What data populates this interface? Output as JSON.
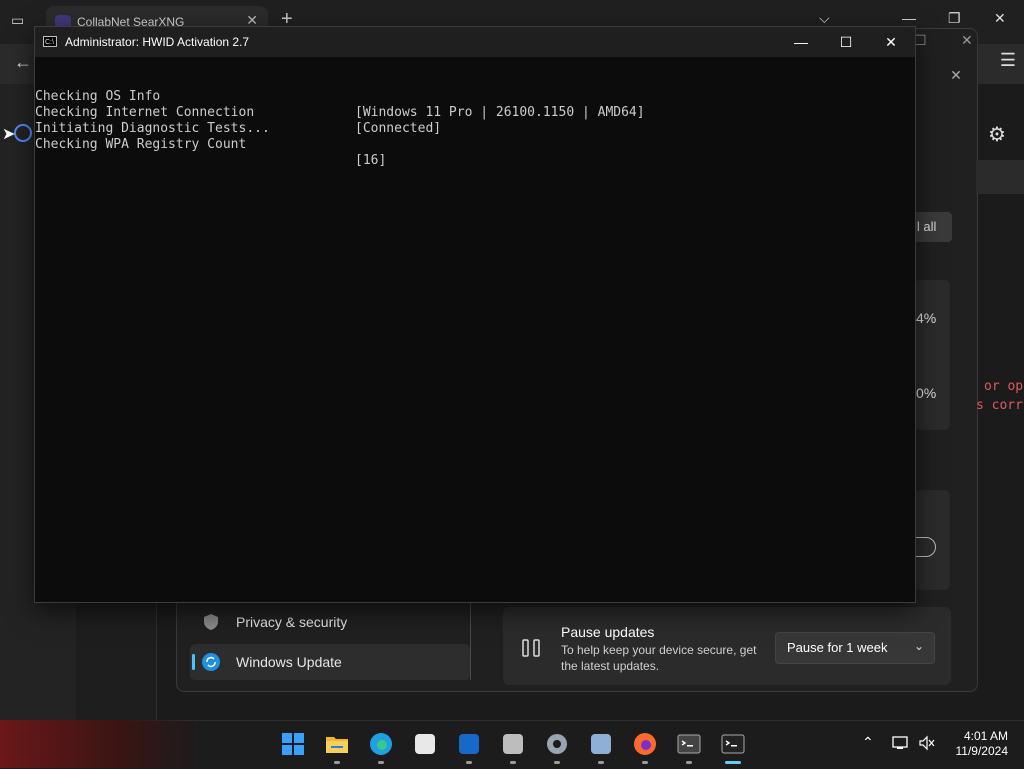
{
  "browser": {
    "tab_title": "CollabNet SearXNG",
    "tab_close": "✕",
    "new_tab": "+",
    "back": "←",
    "menu": "☰",
    "chevron": "⌵",
    "minimize": "—",
    "restore": "❐",
    "close": "✕"
  },
  "settings": {
    "nav": [
      {
        "label": "Privacy & security",
        "icon": "shield-icon"
      },
      {
        "label": "Windows Update",
        "icon": "windows-update-icon"
      }
    ],
    "install_all_fragment": "ll all",
    "percent_1": "4%",
    "percent_2": "0%",
    "pause": {
      "title": "Pause updates",
      "description": "To help keep your device secure, get the latest updates.",
      "selected": "Pause for 1 week",
      "chevron": "⌄"
    },
    "overflow_text_1": "or op",
    "overflow_text_2": "s corr"
  },
  "terminal": {
    "title": "Administrator:  HWID Activation 2.7",
    "icon_glyph": "C:\\",
    "minimize": "—",
    "maximize": "☐",
    "close": "✕",
    "lines": [
      {
        "label": "Checking OS Info",
        "value": "[Windows 11 Pro | 26100.1150 | AMD64]"
      },
      {
        "label": "Checking Internet Connection",
        "value": "[Connected]"
      },
      {
        "label": "Initiating Diagnostic Tests...",
        "value": ""
      },
      {
        "label": "Checking WPA Registry Count",
        "value": "[16]"
      }
    ]
  },
  "taskbar": {
    "apps": [
      {
        "name": "start-icon",
        "color": "#3aa0ff"
      },
      {
        "name": "file-explorer-icon",
        "color": "#f2b632"
      },
      {
        "name": "edge-icon",
        "color": "#1fa1e0"
      },
      {
        "name": "store-icon",
        "color": "#e8e8e8"
      },
      {
        "name": "outlook-new-icon",
        "color": "#1769c9"
      },
      {
        "name": "package-icon",
        "color": "#bdbdbd"
      },
      {
        "name": "settings-icon",
        "color": "#9aa4b0"
      },
      {
        "name": "database-icon",
        "color": "#8fb0d6"
      },
      {
        "name": "firefox-icon",
        "color": "#ff6a2b"
      },
      {
        "name": "terminal-icon",
        "color": "#444444"
      },
      {
        "name": "cmd-icon",
        "color": "#222222"
      }
    ],
    "tray_chevron": "⌃",
    "time": "4:01 AM",
    "date": "11/9/2024"
  }
}
